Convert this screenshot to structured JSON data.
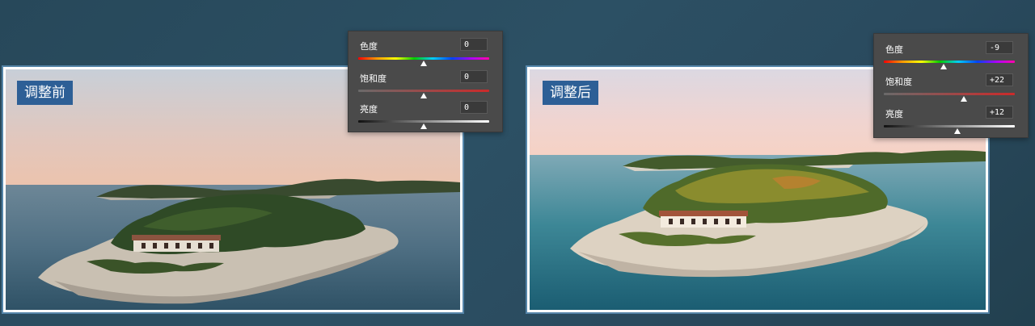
{
  "before": {
    "label": "调整前",
    "adjustments": [
      {
        "label": "色度",
        "value": "0",
        "level": 0.5,
        "track": "hue"
      },
      {
        "label": "饱和度",
        "value": "0",
        "level": 0.5,
        "track": "sat"
      },
      {
        "label": "亮度",
        "value": "0",
        "level": 0.5,
        "track": "lum"
      }
    ]
  },
  "after": {
    "label": "调整后",
    "adjustments": [
      {
        "label": "色度",
        "value": "-9",
        "level": 0.455,
        "track": "hue"
      },
      {
        "label": "饱和度",
        "value": "+22",
        "level": 0.61,
        "track": "sat"
      },
      {
        "label": "亮度",
        "value": "+12",
        "level": 0.56,
        "track": "lum"
      }
    ]
  }
}
